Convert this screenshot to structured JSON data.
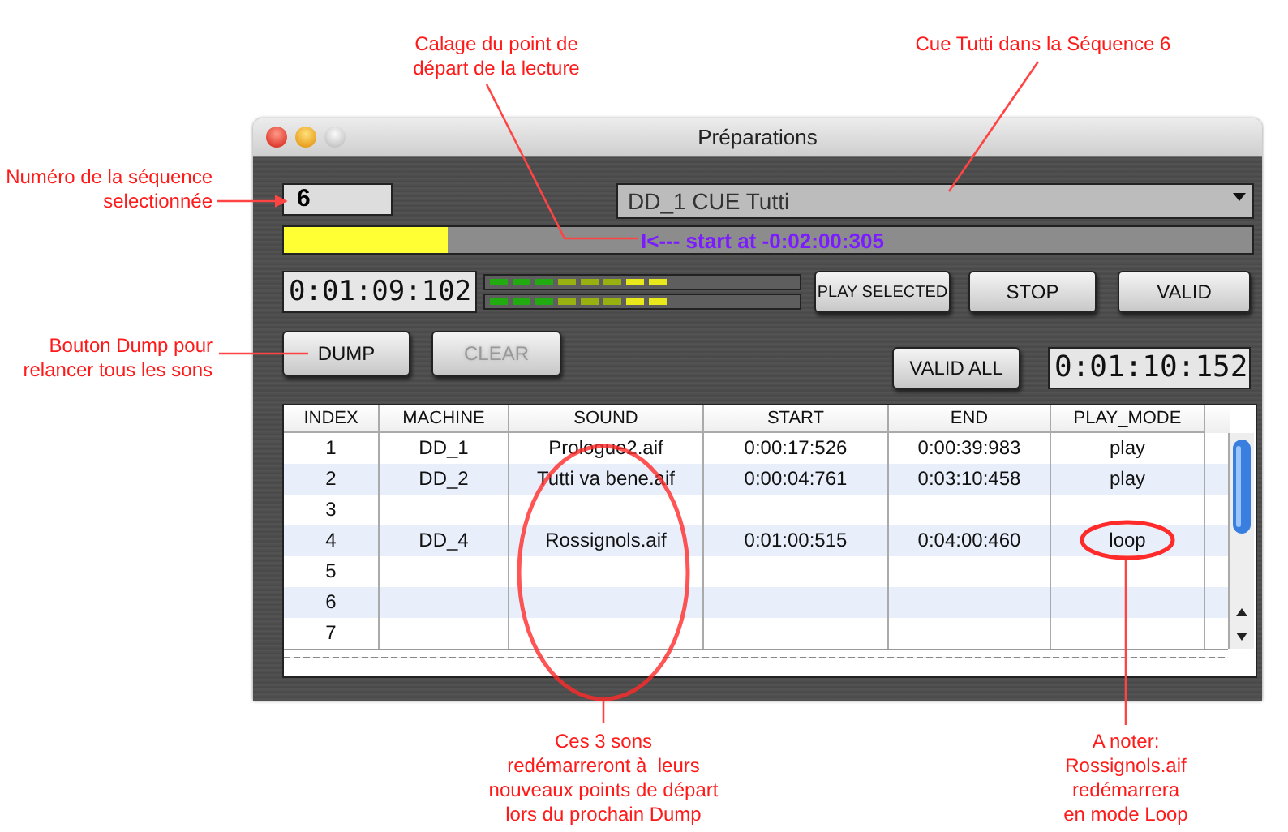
{
  "window": {
    "title": "Préparations"
  },
  "sequence_field": {
    "value": "6"
  },
  "cue_dropdown": {
    "value": "DD_1 CUE Tutti"
  },
  "position_bar": {
    "level": 0.17,
    "label": "I<--- start at -0:02:00:305"
  },
  "time_display_left": "0:01:09:102",
  "meters": [
    {
      "level": 0.58
    },
    {
      "level": 0.58
    }
  ],
  "buttons_top": [
    {
      "label": "PLAY SELECTED",
      "disabled": false
    },
    {
      "label": "STOP",
      "disabled": false
    },
    {
      "label": "VALID",
      "disabled": false
    }
  ],
  "buttons_left": [
    {
      "label": "DUMP",
      "disabled": false
    },
    {
      "label": "CLEAR",
      "disabled": true
    }
  ],
  "valid_all_button": {
    "label": "VALID ALL",
    "disabled": false
  },
  "time_display_right": "0:01:10:152",
  "table": {
    "columns": [
      "INDEX",
      "MACHINE",
      "SOUND",
      "START",
      "END",
      "PLAY_MODE"
    ],
    "rows": [
      {
        "index": "1",
        "machine": "DD_1",
        "sound": "Prologue2.aif",
        "start": "0:00:17:526",
        "end": "0:00:39:983",
        "play_mode": "play"
      },
      {
        "index": "2",
        "machine": "DD_2",
        "sound": "Tutti va bene.aif",
        "start": "0:00:04:761",
        "end": "0:03:10:458",
        "play_mode": "play"
      },
      {
        "index": "3"
      },
      {
        "index": "4",
        "machine": "DD_4",
        "sound": "Rossignols.aif",
        "start": "0:01:00:515",
        "end": "0:04:00:460",
        "play_mode": "loop"
      },
      {
        "index": "5"
      },
      {
        "index": "6"
      },
      {
        "index": "7"
      }
    ]
  },
  "annotations": [
    {
      "text": "Calage du point de\ndépart de la lecture"
    },
    {
      "text": "Cue Tutti dans la Séquence 6"
    },
    {
      "text": "Numéro de la séquence\nselectionnée"
    },
    {
      "text": "Bouton Dump pour\nrelancer tous les sons"
    },
    {
      "text": "Ces 3 sons\nredémarreront à  leurs\nnouveaux points de départ\nlors du prochain Dump"
    },
    {
      "text": "A noter:\nRossignols.aif\nredémarrera\nen mode Loop"
    }
  ]
}
